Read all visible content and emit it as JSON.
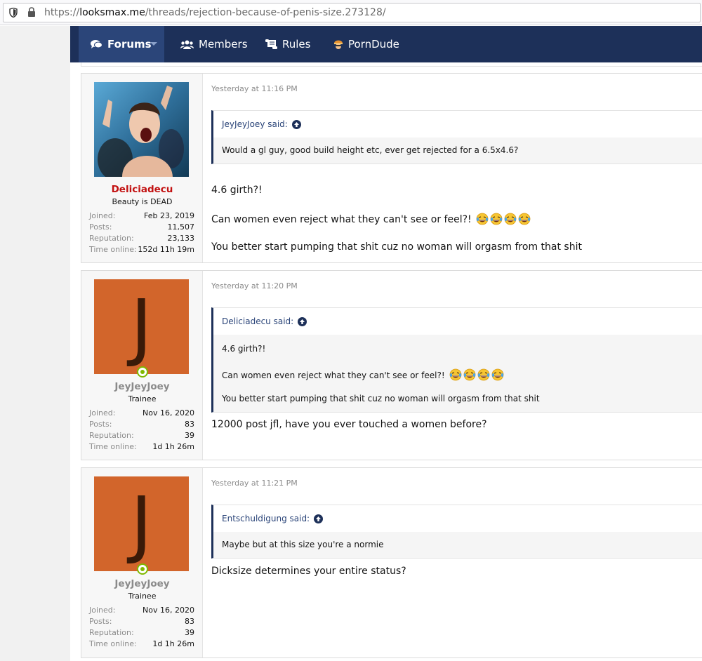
{
  "browser": {
    "url_prefix": "https://",
    "url_domain": "looksmax.me",
    "url_path": "/threads/rejection-because-of-penis-size.273128/"
  },
  "nav": {
    "tabs": [
      {
        "label": "Forums",
        "icon": "comments-icon",
        "active": true
      },
      {
        "label": "Members",
        "icon": "users-icon",
        "active": false
      },
      {
        "label": "Rules",
        "icon": "scroll-icon",
        "active": false
      },
      {
        "label": "PornDude",
        "icon": "porndude-icon",
        "active": false
      }
    ]
  },
  "colors": {
    "nav_bg": "#1d3059",
    "nav_active": "#2b4579",
    "username_red": "#c21010",
    "avatar_orange": "#d2652b",
    "online_green": "#7fb900"
  },
  "posts": [
    {
      "user": {
        "name": "Deliciadecu",
        "title": "Beauty is DEAD",
        "avatar": "photo-avatar",
        "joined": "Feb 23, 2019",
        "posts": "11,507",
        "reputation": "23,133",
        "time_online": "152d 11h 19m"
      },
      "date": "Yesterday at 11:16 PM",
      "quote": {
        "author": "JeyJeyJoey said:",
        "lines": [
          "Would a gl guy, good build height etc, ever get rejected for a 6.5x4.6?"
        ]
      },
      "message": [
        "4.6 girth?!",
        "Can women even reject what they can't see or feel?!",
        "You better start pumping that shit cuz no woman will orgasm from that shit"
      ]
    },
    {
      "user": {
        "name": "JeyJeyJoey",
        "title": "Trainee",
        "avatar_letter": "J",
        "joined": "Nov 16, 2020",
        "posts": "83",
        "reputation": "39",
        "time_online": "1d 1h 26m"
      },
      "date": "Yesterday at 11:20 PM",
      "quote": {
        "author": "Deliciadecu said:",
        "lines": [
          "4.6 girth?!",
          "Can women even reject what they can't see or feel?!",
          "You better start pumping that shit cuz no woman will orgasm from that shit"
        ]
      },
      "message": [
        "12000 post jfl, have you ever touched a women before?"
      ]
    },
    {
      "user": {
        "name": "JeyJeyJoey",
        "title": "Trainee",
        "avatar_letter": "J",
        "joined": "Nov 16, 2020",
        "posts": "83",
        "reputation": "39",
        "time_online": "1d 1h 26m"
      },
      "date": "Yesterday at 11:21 PM",
      "quote": {
        "author": "Entschuldigung said:",
        "lines": [
          "Maybe but at this size you're a normie"
        ]
      },
      "message": [
        "Dicksize determines your entire status?"
      ]
    }
  ],
  "labels": {
    "joined": "Joined:",
    "posts": "Posts:",
    "reputation": "Reputation:",
    "time_online": "Time online:"
  }
}
